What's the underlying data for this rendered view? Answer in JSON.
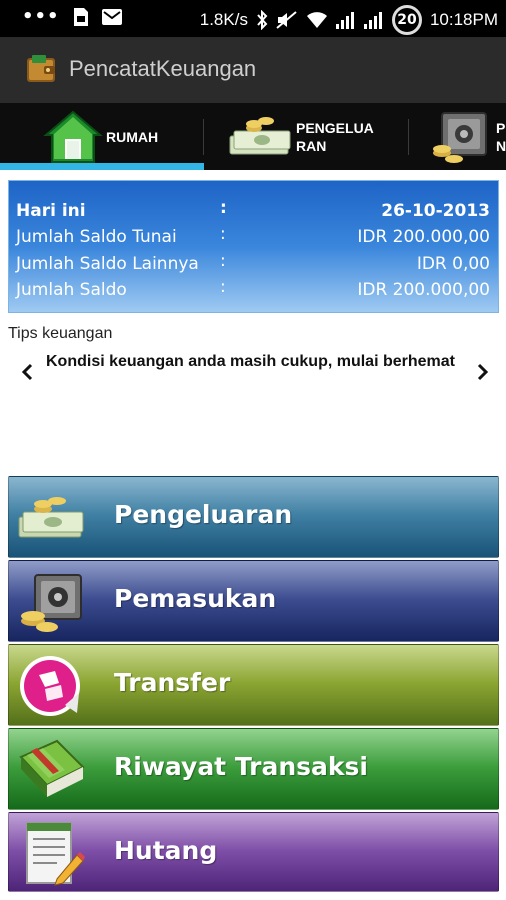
{
  "status_bar": {
    "dots": "•••",
    "network_speed": "1.8K/s",
    "battery_level": "20",
    "time": "10:18PM"
  },
  "app": {
    "title": "PencatatKeuangan"
  },
  "tabs": [
    {
      "label": "RUMAH",
      "icon": "house-icon",
      "selected": true
    },
    {
      "label_line1": "PENGELUA",
      "label_line2": "RAN",
      "icon": "money-icon"
    },
    {
      "label_line1": "P",
      "label_line2": "N",
      "icon": "safe-icon"
    }
  ],
  "summary": {
    "rows": [
      {
        "label": "Hari ini",
        "colon": ":",
        "value": "26-10-2013"
      },
      {
        "label": "Jumlah Saldo Tunai",
        "colon": ":",
        "value": "IDR 200.000,00"
      },
      {
        "label": "Jumlah Saldo Lainnya",
        "colon": ":",
        "value": "IDR 0,00"
      },
      {
        "label": "Jumlah Saldo",
        "colon": ":",
        "value": "IDR 200.000,00"
      }
    ]
  },
  "tips": {
    "title": "Tips keuangan",
    "text": "Kondisi keuangan anda masih cukup, mulai berhemat"
  },
  "menu": [
    {
      "label": "Pengeluaran",
      "icon": "money-icon"
    },
    {
      "label": "Pemasukan",
      "icon": "safe-icon"
    },
    {
      "label": "Transfer",
      "icon": "transfer-icon"
    },
    {
      "label": "Riwayat Transaksi",
      "icon": "book-icon"
    },
    {
      "label": "Hutang",
      "icon": "notepad-icon"
    }
  ],
  "colors": {
    "tab_indicator": "#33b5e5",
    "summary_top": "#1e64c6",
    "summary_bottom": "#9fcaf2"
  }
}
